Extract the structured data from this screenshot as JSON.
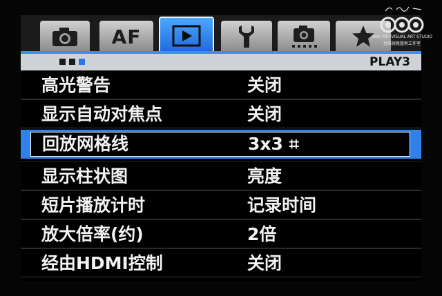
{
  "tabs": [
    {
      "id": "shooting",
      "icon": "camera-icon",
      "label": ""
    },
    {
      "id": "af",
      "icon": "",
      "label": "AF"
    },
    {
      "id": "playback",
      "icon": "play-icon",
      "label": "",
      "active": true
    },
    {
      "id": "setup",
      "icon": "wrench-icon",
      "label": ""
    },
    {
      "id": "custom",
      "icon": "custom-camera-icon",
      "label": ""
    },
    {
      "id": "mymenu",
      "icon": "star-icon",
      "label": ""
    }
  ],
  "subbar": {
    "page_name": "PLAY3",
    "page_dots": 3,
    "current_dot": 3
  },
  "menu": {
    "items": [
      {
        "label": "高光警告",
        "value": "关闭"
      },
      {
        "label": "显示自动对焦点",
        "value": "关闭"
      },
      {
        "label": "回放网格线",
        "value": "3x3 ⌗",
        "selected": true
      },
      {
        "label": "显示柱状图",
        "value": "亮度"
      },
      {
        "label": "短片播放计时",
        "value": "记录时间"
      },
      {
        "label": "放大倍率(约)",
        "value": "2倍"
      },
      {
        "label": "经由HDMI控制",
        "value": "关闭"
      }
    ]
  },
  "watermark": {
    "line1": "JINXI MEI VISUAL ART STUDIO",
    "line2": "金西視覺藝術工作室"
  },
  "colors": {
    "accent": "#2f80e8",
    "tab_active": "#3b8ff0",
    "background": "#000000",
    "text": "#f2f2f2"
  }
}
